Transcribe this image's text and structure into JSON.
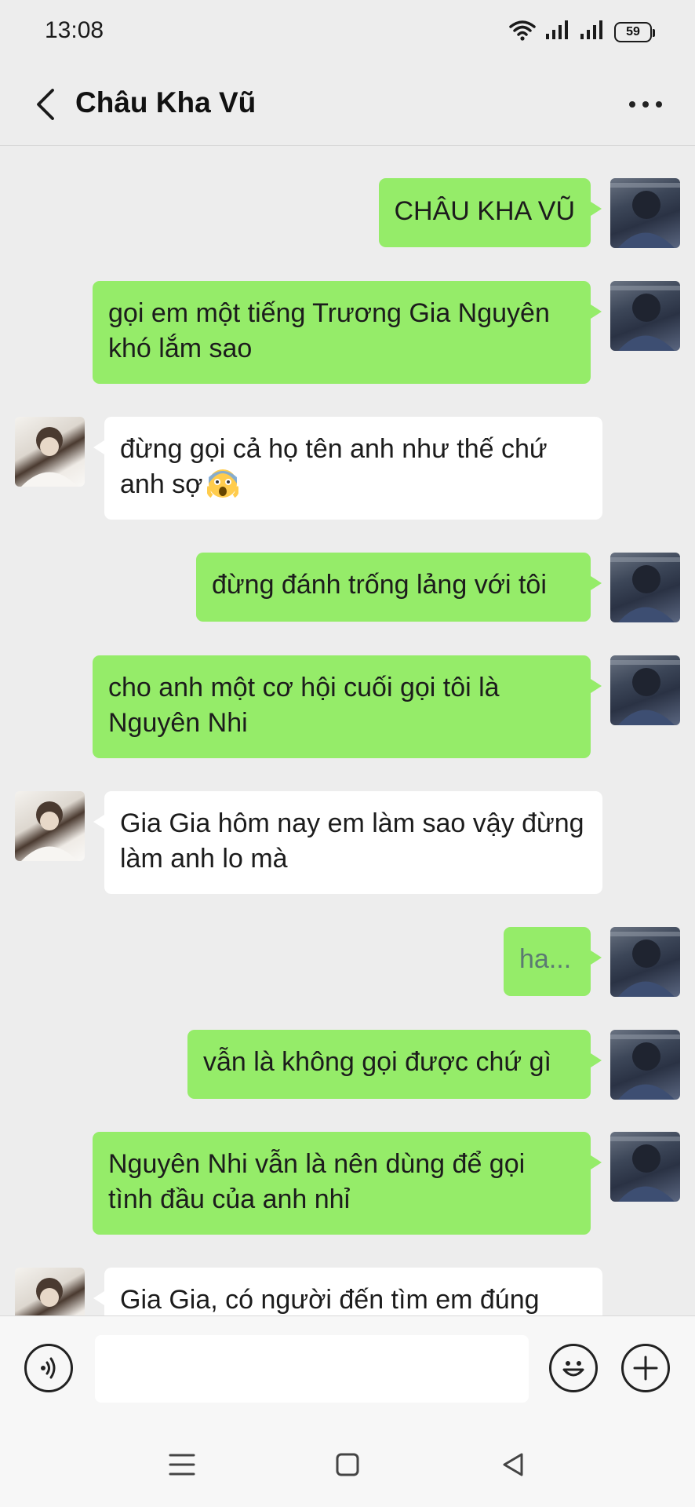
{
  "status_bar": {
    "time": "13:08",
    "battery": "59",
    "icons": [
      "wifi-icon",
      "signal-icon",
      "signal-icon",
      "battery-icon"
    ]
  },
  "header": {
    "title": "Châu Kha Vũ",
    "back_icon": "chevron-left-icon",
    "more_icon": "more-dots-icon"
  },
  "messages": [
    {
      "sender": "me",
      "text": "CHÂU KHA VŨ"
    },
    {
      "sender": "me",
      "text": "gọi em một tiếng Trương Gia Nguyên khó lắm sao"
    },
    {
      "sender": "other",
      "text": "đừng gọi cả họ tên anh như thế chứ anh sợ",
      "emoji": "screaming-face-emoji"
    },
    {
      "sender": "me",
      "text": "đừng đánh trống lảng với tôi"
    },
    {
      "sender": "me",
      "text": "cho anh một cơ hội cuối gọi tôi là Nguyên Nhi"
    },
    {
      "sender": "other",
      "text": "Gia Gia hôm nay em làm sao vậy đừng làm anh lo mà"
    },
    {
      "sender": "me",
      "text": "ha..."
    },
    {
      "sender": "me",
      "text": "vẫn là không gọi được chứ gì"
    },
    {
      "sender": "me",
      "text": "Nguyên Nhi vẫn là nên dùng để gọi tình đầu của anh nhỉ"
    },
    {
      "sender": "other",
      "text": "Gia Gia, có người đến tìm em đúng"
    }
  ],
  "input_bar": {
    "voice_icon": "voice-icon",
    "emoji_icon": "emoji-icon",
    "plus_icon": "plus-circle-icon",
    "input_value": ""
  },
  "nav_bar": {
    "icons": [
      "menu-icon",
      "home-square-icon",
      "back-triangle-icon"
    ]
  },
  "colors": {
    "background": "#ededed",
    "bubble_me": "#95ec69",
    "bubble_other": "#ffffff"
  }
}
